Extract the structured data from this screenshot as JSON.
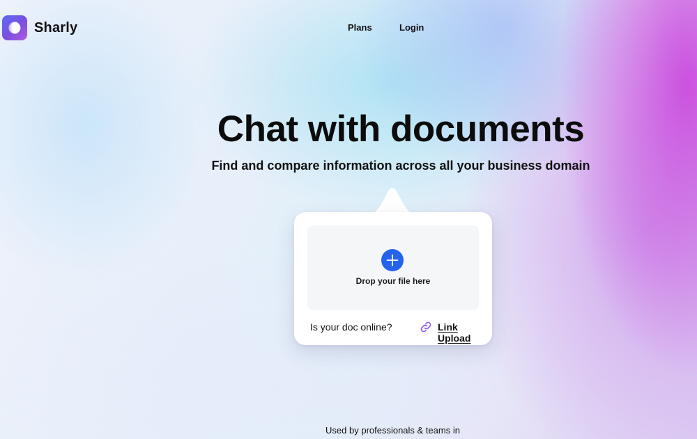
{
  "brand": {
    "name": "Sharly",
    "logo_icon": "sharly-logo-icon",
    "accent": "#6b5ce7"
  },
  "nav": {
    "plans": "Plans",
    "login": "Login"
  },
  "hero": {
    "title": "Chat with documents",
    "subtitle": "Find and compare information across all your business domain"
  },
  "upload": {
    "drop_label": "Drop your file here",
    "add_icon": "plus-icon",
    "add_color": "#2563eb",
    "online_question": "Is your doc online?",
    "link_icon": "link-icon",
    "link_color": "#8b5cf6",
    "link_label": "Link Upload"
  },
  "footer": {
    "used_by": "Used by professionals & teams in"
  }
}
